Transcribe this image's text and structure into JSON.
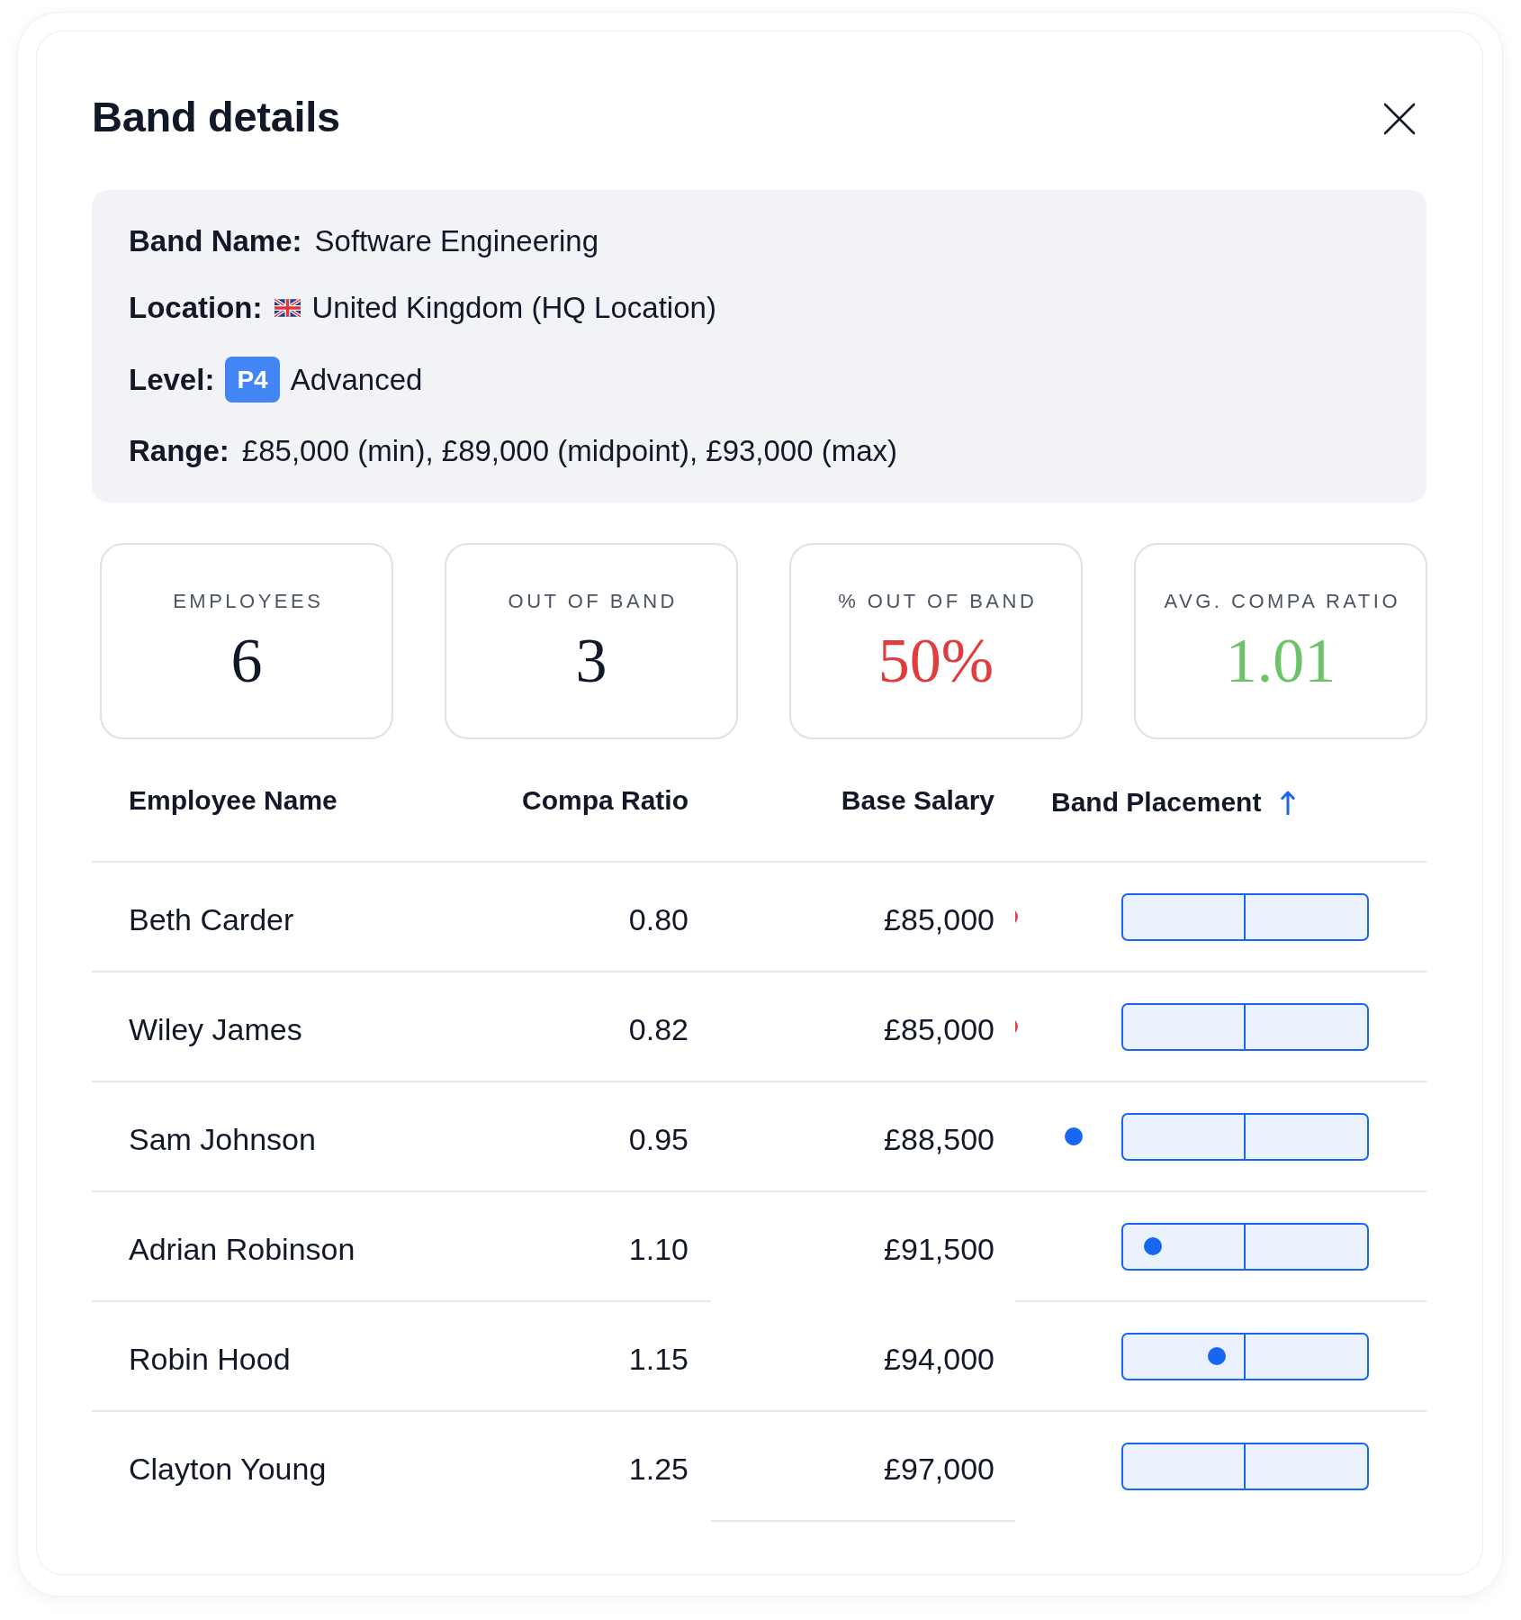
{
  "dialog": {
    "title": "Band details"
  },
  "details": [
    {
      "kind": "text",
      "label": "Band Name:",
      "value": "Software Engineering"
    },
    {
      "kind": "flag",
      "label": "Location:",
      "value": "United Kingdom (HQ Location)"
    },
    {
      "kind": "level",
      "label": "Level:",
      "badge": "P4",
      "value": "Advanced"
    },
    {
      "kind": "text",
      "label": "Range:",
      "value": "£85,000 (min), £89,000 (midpoint), £93,000 (max)"
    }
  ],
  "stats": [
    {
      "label": "EMPLOYEES",
      "value": "6",
      "color": "#111827"
    },
    {
      "label": "OUT OF BAND",
      "value": "3",
      "color": "#111827"
    },
    {
      "label": "% OUT OF BAND",
      "value": "50%",
      "color": "#e03e3e"
    },
    {
      "label": "AVG. COMPA RATIO",
      "value": "1.01",
      "color": "#6cc46a"
    }
  ],
  "table": {
    "columns": [
      {
        "label": "Employee Name",
        "sorted": false
      },
      {
        "label": "Compa Ratio",
        "sorted": false
      },
      {
        "label": "Base Salary",
        "sorted": false
      },
      {
        "label": "Band Placement",
        "sorted": true
      }
    ],
    "rows": [
      {
        "name": "Beth Carder",
        "compa_ratio": "0.80",
        "base_salary": "£85,000",
        "marker": {
          "level": 0,
          "color": "#e8414a"
        }
      },
      {
        "name": "Wiley James",
        "compa_ratio": "0.82",
        "base_salary": "£85,000",
        "marker": {
          "level": 0,
          "color": "#e8414a"
        }
      },
      {
        "name": "Sam Johnson",
        "compa_ratio": "0.95",
        "base_salary": "£88,500",
        "marker": {
          "level": 0.155,
          "color": "#1767f2"
        }
      },
      {
        "name": "Adrian Robinson",
        "compa_ratio": "1.10",
        "base_salary": "£91,500",
        "marker": {
          "level": 0.348,
          "color": "#1767f2"
        }
      },
      {
        "name": "Robin Hood",
        "compa_ratio": "1.15",
        "base_salary": "£94,000",
        "marker": {
          "level": 0.503,
          "color": "#1767f2"
        }
      },
      {
        "name": "Clayton Young",
        "compa_ratio": "1.25",
        "base_salary": "£97,000"
      }
    ]
  }
}
